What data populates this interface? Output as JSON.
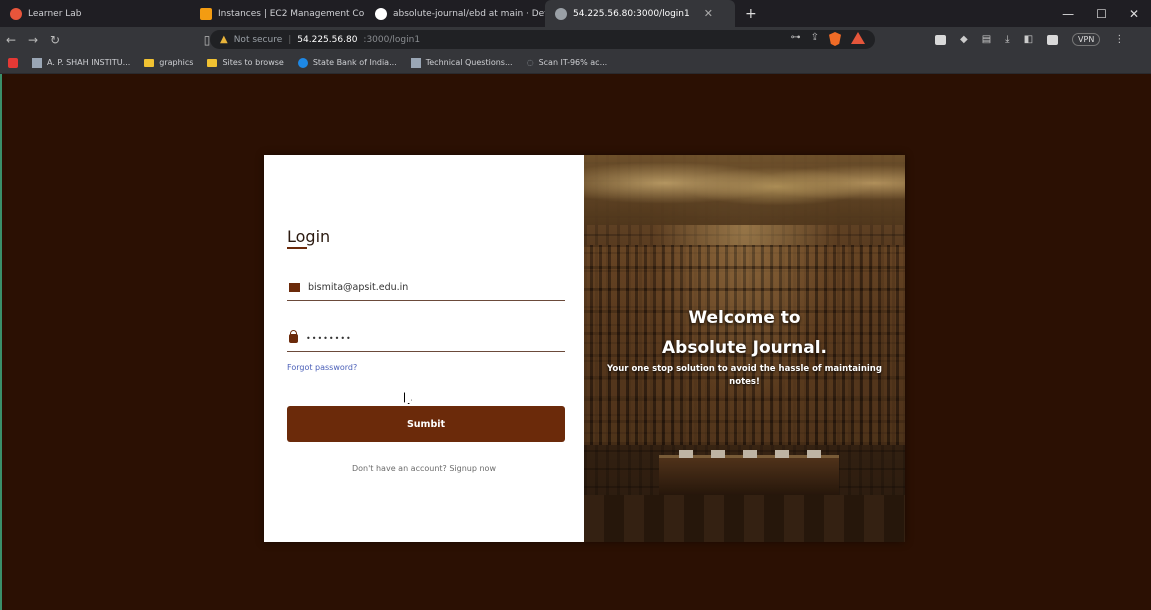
{
  "browser": {
    "tabs": [
      {
        "label": "Learner Lab",
        "color": "#e8553b",
        "active": false
      },
      {
        "label": "Instances | EC2 Management Console",
        "color": "#f39c12",
        "active": false
      },
      {
        "label": "absolute-journal/ebd at main · Dev...",
        "color": "#ffffff",
        "active": false
      },
      {
        "label": "54.225.56.80:3000/login1",
        "color": "#9aa0a6",
        "active": true
      }
    ],
    "new_tab": "+",
    "window_controls": {
      "minimize": "—",
      "maximize": "☐",
      "close": "✕"
    },
    "address": {
      "security": "Not secure",
      "host": "54.225.56.80",
      "path": ":3000/login1"
    },
    "profile_chip": "VPN",
    "bookmarks": [
      {
        "label": "A. P. SHAH INSTITU...",
        "icon": "sq"
      },
      {
        "label": "graphics",
        "icon": "folder"
      },
      {
        "label": "Sites to browse",
        "icon": "folder"
      },
      {
        "label": "State Bank of India...",
        "icon": "blue"
      },
      {
        "label": "Technical Questions...",
        "icon": "sq"
      },
      {
        "label": "Scan IT-96% ac...",
        "icon": "sq"
      }
    ]
  },
  "login": {
    "title": "Login",
    "email_value": "bismita@apsit.edu.in",
    "password_value": "••••••••",
    "forgot_label": "Forgot password?",
    "submit_label": "Sumbit",
    "signup_text": "Don't have an account?",
    "signup_link": "Signup now"
  },
  "welcome": {
    "line1": "Welcome to",
    "line2": "Absolute Journal.",
    "subtitle": "Your one stop solution to avoid the hassle of maintaining notes!"
  },
  "colors": {
    "page_bg": "#2b1003",
    "accent": "#6b2a0a",
    "link": "#4a5fb8"
  }
}
